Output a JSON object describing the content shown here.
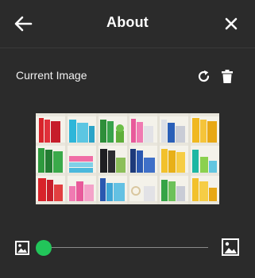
{
  "header": {
    "title": "About",
    "back_icon": "arrow-left-icon",
    "close_icon": "close-icon"
  },
  "section": {
    "label": "Current Image",
    "rotate_icon": "rotate-icon",
    "delete_icon": "trash-icon"
  },
  "image": {
    "description_icon": "bookshelf-photo"
  },
  "zoom": {
    "small_icon": "image-small-icon",
    "large_icon": "image-large-icon",
    "value": 0.0
  },
  "colors": {
    "background": "#2b2b2b",
    "accent": "#22c55a"
  }
}
